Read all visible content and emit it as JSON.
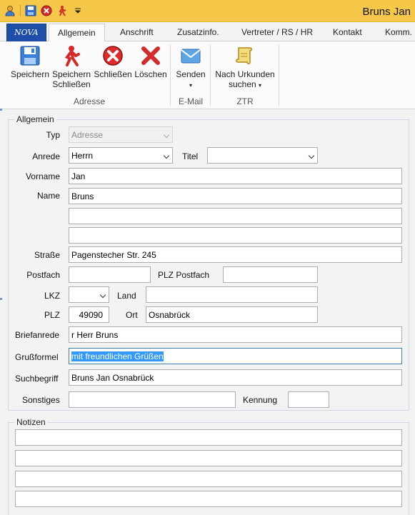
{
  "window": {
    "title": "Bruns Jan"
  },
  "tabs": [
    {
      "label": "Allgemein",
      "active": true
    },
    {
      "label": "Anschrift"
    },
    {
      "label": "Zusatzinfo."
    },
    {
      "label": "Vertreter / RS / HR"
    },
    {
      "label": "Kontakt"
    },
    {
      "label": "Komm."
    }
  ],
  "logo_text": "NOVA",
  "ribbon": {
    "speichern": "Speichern",
    "speichern_schliessen_1": "Speichern",
    "speichern_schliessen_2": "Schließen",
    "schliessen": "Schließen",
    "loeschen": "Löschen",
    "group_adresse": "Adresse",
    "senden": "Senden",
    "group_email": "E-Mail",
    "urkunden_1": "Nach Urkunden",
    "urkunden_2": "suchen",
    "group_ztr": "ZTR"
  },
  "form": {
    "group_title": "Allgemein",
    "typ_label": "Typ",
    "typ_value": "Adresse",
    "anrede_label": "Anrede",
    "anrede_value": "Herrn",
    "titel_label": "Titel",
    "titel_value": "",
    "vorname_label": "Vorname",
    "vorname_value": "Jan",
    "name_label": "Name",
    "name_value": "Bruns",
    "name2_value": "",
    "name3_value": "",
    "strasse_label": "Straße",
    "strasse_value": "Pagenstecher Str. 245",
    "postfach_label": "Postfach",
    "postfach_value": "",
    "plz_postfach_label": "PLZ Postfach",
    "plz_postfach_value": "",
    "lkz_label": "LKZ",
    "lkz_value": "",
    "land_label": "Land",
    "land_value": "",
    "plz_label": "PLZ",
    "plz_value": "49090",
    "ort_label": "Ort",
    "ort_value": "Osnabrück",
    "briefanrede_label": "Briefanrede",
    "briefanrede_value": "r Herr Bruns",
    "grussformel_label": "Grußformel",
    "grussformel_value": "mit freundlichen Grüßen",
    "suchbegriff_label": "Suchbegriff",
    "suchbegriff_value": "Bruns Jan Osnabrück",
    "sonstiges_label": "Sonstiges",
    "sonstiges_value": "",
    "kennung_label": "Kennung",
    "kennung_value": ""
  },
  "notizen": {
    "group_title": "Notizen",
    "lines": [
      "",
      "",
      "",
      ""
    ]
  },
  "colors": {
    "titlebar": "#f5c84a",
    "logo_tab": "#1f4ea8",
    "selection": "#3399ff"
  }
}
